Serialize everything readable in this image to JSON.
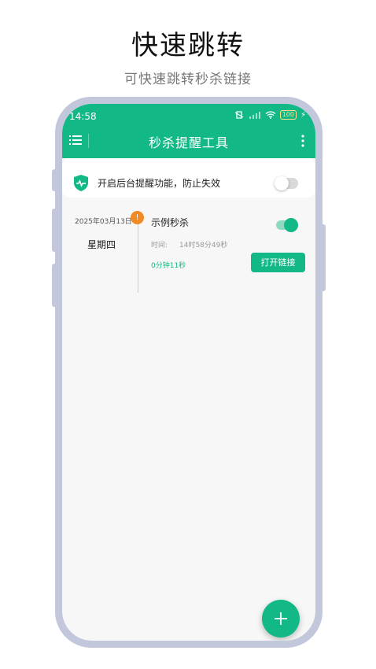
{
  "promo": {
    "title": "快速跳转",
    "subtitle": "可快速跳转秒杀链接"
  },
  "status_bar": {
    "time": "14:58",
    "battery": "100",
    "icons": [
      "vibrate-off-icon",
      "signal-icon",
      "wifi-icon",
      "battery-icon",
      "charging-icon"
    ]
  },
  "header": {
    "title": "秒杀提醒工具",
    "left_icon": "menu-icon",
    "right_icon": "more-vertical-icon"
  },
  "reminder": {
    "icon": "shield-pulse-icon",
    "text": "开启后台提醒功能，防止失效",
    "enabled": false
  },
  "items": [
    {
      "date": "2025年03月13日",
      "weekday": "星期四",
      "title": "示例秒杀",
      "enabled": true,
      "time_label": "时间:",
      "time_value": "14时58分49秒",
      "countdown": "0分钟11秒",
      "button_label": "打开链接"
    }
  ],
  "fab": {
    "icon": "plus-icon"
  },
  "colors": {
    "accent": "#12b886",
    "warning": "#f08a24",
    "frame": "#c3c7dc"
  }
}
